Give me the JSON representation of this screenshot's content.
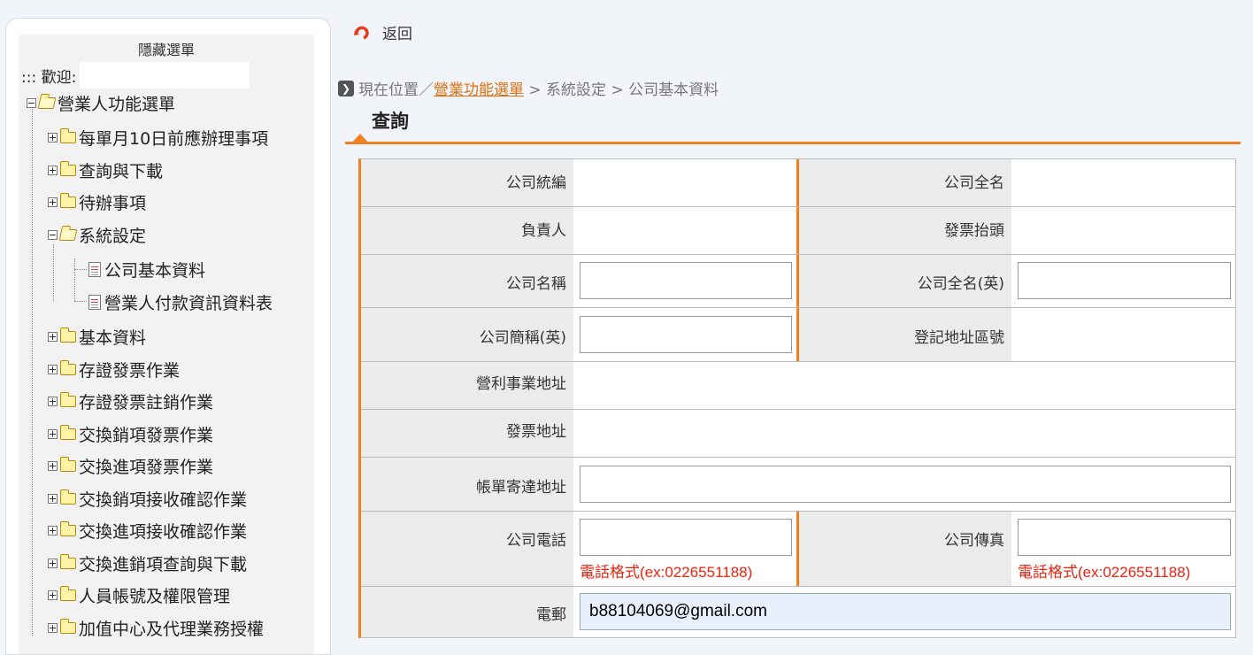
{
  "sidebar": {
    "hide_menu": "隱藏選單",
    "welcome_label": "::: 歡迎:",
    "root_label": "營業人功能選單",
    "items": [
      {
        "label": "每單月10日前應辦理事項"
      },
      {
        "label": "查詢與下載"
      },
      {
        "label": "待辦事項"
      },
      {
        "label": "系統設定"
      },
      {
        "label": "公司基本資料"
      },
      {
        "label": "營業人付款資訊資料表"
      },
      {
        "label": "基本資料"
      },
      {
        "label": "存證發票作業"
      },
      {
        "label": "存證發票註銷作業"
      },
      {
        "label": "交換銷項發票作業"
      },
      {
        "label": "交換進項發票作業"
      },
      {
        "label": "交換銷項接收確認作業"
      },
      {
        "label": "交換進項接收確認作業"
      },
      {
        "label": "交換進銷項查詢與下載"
      },
      {
        "label": "人員帳號及權限管理"
      },
      {
        "label": "加值中心及代理業務授權"
      }
    ]
  },
  "header": {
    "back_label": "返回"
  },
  "breadcrumb": {
    "prefix": "現在位置",
    "sep1": "／",
    "link": "營業功能選單",
    "rest": " > 系統設定 > 公司基本資料"
  },
  "section_title": "查詢",
  "form": {
    "labels": {
      "tax_id": "公司統編",
      "full_name": "公司全名",
      "owner": "負責人",
      "invoice_title": "發票抬頭",
      "company_name": "公司名稱",
      "full_name_en": "公司全名(英)",
      "short_name_en": "公司簡稱(英)",
      "reg_zip": "登記地址區號",
      "business_address": "營利事業地址",
      "invoice_address": "發票地址",
      "bill_address": "帳單寄達地址",
      "phone": "公司電話",
      "fax": "公司傳真",
      "email": "電郵"
    },
    "values": {
      "company_name": "",
      "full_name_en": "",
      "short_name_en": "",
      "bill_address": "",
      "phone": "",
      "fax": "",
      "email": "b88104069@gmail.com"
    },
    "phone_hint": "電話格式(ex:0226551188)",
    "fax_hint": "電話格式(ex:0226551188)"
  },
  "colors": {
    "accent": "#f08020",
    "link": "#e07010",
    "hint": "#ee2211"
  }
}
